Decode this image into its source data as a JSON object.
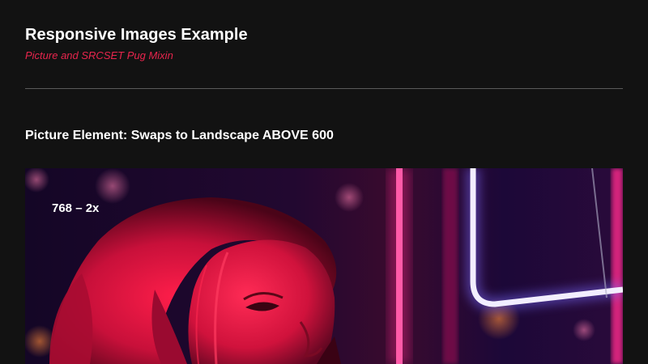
{
  "header": {
    "title": "Responsive Images Example",
    "subtitle": "Picture and SRCSET Pug Mixin"
  },
  "section": {
    "heading": "Picture Element: Swaps to Landscape ABOVE 600"
  },
  "picture": {
    "label": "768 – 2x",
    "subject": "woman-neon-portrait"
  },
  "colors": {
    "background": "#121212",
    "accent": "#e8254d",
    "divider": "#5a5a5a",
    "neon_white": "#f2eeff",
    "neon_pink": "#ff2a8c"
  }
}
